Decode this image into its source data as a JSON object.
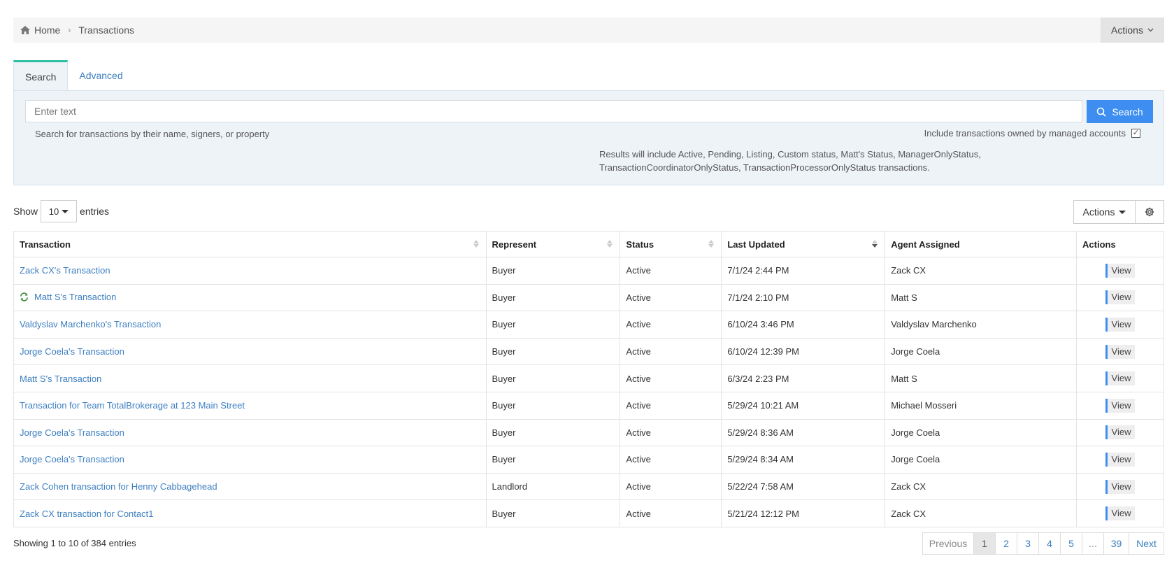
{
  "breadcrumb": {
    "home": "Home",
    "current": "Transactions"
  },
  "header": {
    "actions_label": "Actions"
  },
  "tabs": [
    {
      "label": "Search"
    },
    {
      "label": "Advanced"
    }
  ],
  "search": {
    "placeholder": "Enter text",
    "button_label": "Search",
    "hint": "Search for transactions by their name, signers, or property",
    "include_label": "Include transactions owned by managed accounts",
    "include_checked": true,
    "checkmark": "✓",
    "results_note_line1": "Results will include Active, Pending, Listing, Custom status, Matt's Status, ManagerOnlyStatus,",
    "results_note_line2": "TransactionCoordinatorOnlyStatus, TransactionProcessorOnlyStatus transactions."
  },
  "entries": {
    "show_label": "Show",
    "value": "10",
    "suffix": "entries"
  },
  "table_toolbar": {
    "actions_label": "Actions"
  },
  "table": {
    "columns": [
      "Transaction",
      "Represent",
      "Status",
      "Last Updated",
      "Agent Assigned",
      "Actions"
    ],
    "view_label": "View",
    "rows": [
      {
        "transaction": "Zack CX's Transaction",
        "represent": "Buyer",
        "status": "Active",
        "updated": "7/1/24 2:44 PM",
        "agent": "Zack CX"
      },
      {
        "transaction": "Matt S's Transaction",
        "represent": "Buyer",
        "status": "Active",
        "updated": "7/1/24 2:10 PM",
        "agent": "Matt S"
      },
      {
        "transaction": "Valdyslav Marchenko's Transaction",
        "represent": "Buyer",
        "status": "Active",
        "updated": "6/10/24 3:46 PM",
        "agent": "Valdyslav Marchenko"
      },
      {
        "transaction": "Jorge Coela's Transaction",
        "represent": "Buyer",
        "status": "Active",
        "updated": "6/10/24 12:39 PM",
        "agent": "Jorge Coela"
      },
      {
        "transaction": "Matt S's Transaction",
        "represent": "Buyer",
        "status": "Active",
        "updated": "6/3/24 2:23 PM",
        "agent": "Matt S"
      },
      {
        "transaction": "Transaction for Team TotalBrokerage at 123 Main Street",
        "represent": "Buyer",
        "status": "Active",
        "updated": "5/29/24 10:21 AM",
        "agent": "Michael Mosseri"
      },
      {
        "transaction": "Jorge Coela's Transaction",
        "represent": "Buyer",
        "status": "Active",
        "updated": "5/29/24 8:36 AM",
        "agent": "Jorge Coela"
      },
      {
        "transaction": "Jorge Coela's Transaction",
        "represent": "Buyer",
        "status": "Active",
        "updated": "5/29/24 8:34 AM",
        "agent": "Jorge Coela"
      },
      {
        "transaction": "Zack Cohen transaction for Henny Cabbagehead",
        "represent": "Landlord",
        "status": "Active",
        "updated": "5/22/24 7:58 AM",
        "agent": "Zack CX"
      },
      {
        "transaction": "Zack CX transaction for Contact1",
        "represent": "Buyer",
        "status": "Active",
        "updated": "5/21/24 12:12 PM",
        "agent": "Zack CX"
      }
    ]
  },
  "footer": {
    "showing": "Showing 1 to 10 of 384 entries",
    "pagination": [
      "Previous",
      "1",
      "2",
      "3",
      "4",
      "5",
      "...",
      "39",
      "Next"
    ]
  },
  "colors": {
    "accent": "#3d8ef0",
    "link": "#3d7fc1",
    "tab_indicator": "#2dbfa4",
    "sync_icon": "#3a8a3a"
  },
  "icons": {
    "home": "home-icon",
    "chevron": "chevron-right-icon",
    "search": "search-icon",
    "gear": "gear-icon",
    "sync": "sync-icon"
  }
}
